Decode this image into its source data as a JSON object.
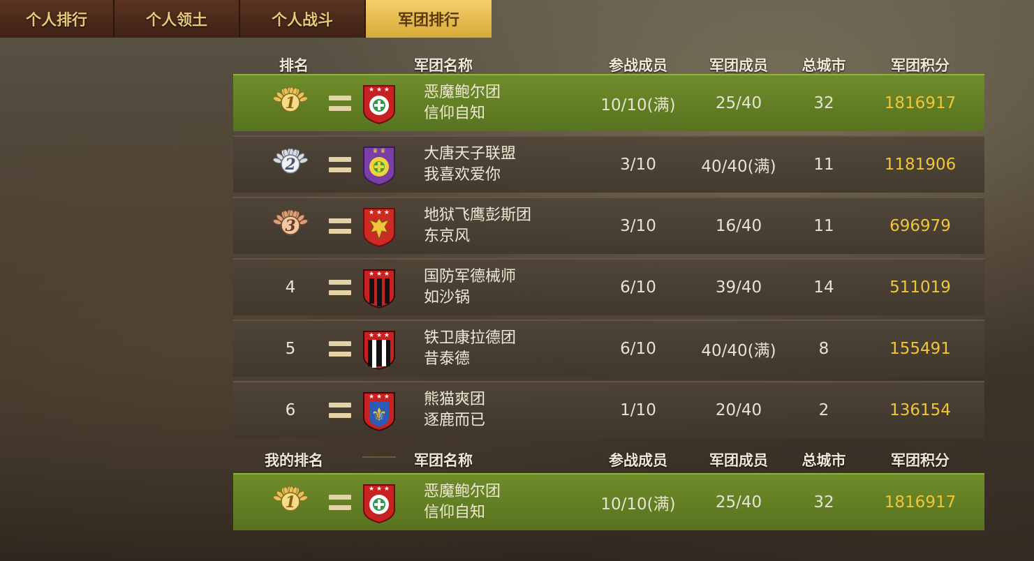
{
  "tabs": [
    {
      "label": "个人排行",
      "active": false
    },
    {
      "label": "个人领土",
      "active": false
    },
    {
      "label": "个人战斗",
      "active": false
    },
    {
      "label": "军团排行",
      "active": true
    }
  ],
  "table_header": {
    "rank": "排名",
    "legion_name": "军团名称",
    "participants": "参战成员",
    "members": "军团成员",
    "cities": "总城市",
    "score": "军团积分"
  },
  "my_header": {
    "rank": "我的排名",
    "legion_name": "军团名称",
    "participants": "参战成员",
    "members": "军团成员",
    "cities": "总城市",
    "score": "军团积分"
  },
  "rows": [
    {
      "rank": "1",
      "medal": "gold",
      "emblem": "red-white-cross",
      "name": "恶魔鲍尔团",
      "leader": "信仰自知",
      "participants": "10/10(满)",
      "members": "25/40",
      "cities": "32",
      "score": "1816917"
    },
    {
      "rank": "2",
      "medal": "silver",
      "emblem": "purple-yellow-cross",
      "name": "大唐天子联盟",
      "leader": "我喜欢爱你",
      "participants": "3/10",
      "members": "40/40(满)",
      "cities": "11",
      "score": "1181906"
    },
    {
      "rank": "3",
      "medal": "bronze",
      "emblem": "red-eagle",
      "name": "地狱飞鹰彭斯团",
      "leader": "东京风",
      "participants": "3/10",
      "members": "16/40",
      "cities": "11",
      "score": "696979"
    },
    {
      "rank": "4",
      "medal": "",
      "emblem": "red-black-stripes",
      "name": "国防军德械师",
      "leader": "如沙锅",
      "participants": "6/10",
      "members": "39/40",
      "cities": "14",
      "score": "511019"
    },
    {
      "rank": "5",
      "medal": "",
      "emblem": "black-white-stripes",
      "name": "铁卫康拉德团",
      "leader": "昔泰德",
      "participants": "6/10",
      "members": "40/40(满)",
      "cities": "8",
      "score": "155491"
    },
    {
      "rank": "6",
      "medal": "",
      "emblem": "blue-fleur-de-lis",
      "name": "熊猫爽团",
      "leader": "逐鹿而已",
      "participants": "1/10",
      "members": "20/40",
      "cities": "2",
      "score": "136154"
    }
  ],
  "my_row": {
    "rank": "1",
    "medal": "gold",
    "emblem": "red-white-cross",
    "name": "恶魔鲍尔团",
    "leader": "信仰自知",
    "participants": "10/10(满)",
    "members": "25/40",
    "cities": "32",
    "score": "1816917"
  },
  "colors": {
    "highlight_row": "#6f8c2a",
    "score": "#f0c53a",
    "tab_active": "#f2cf69",
    "tab_inactive": "#4a2a1b"
  }
}
